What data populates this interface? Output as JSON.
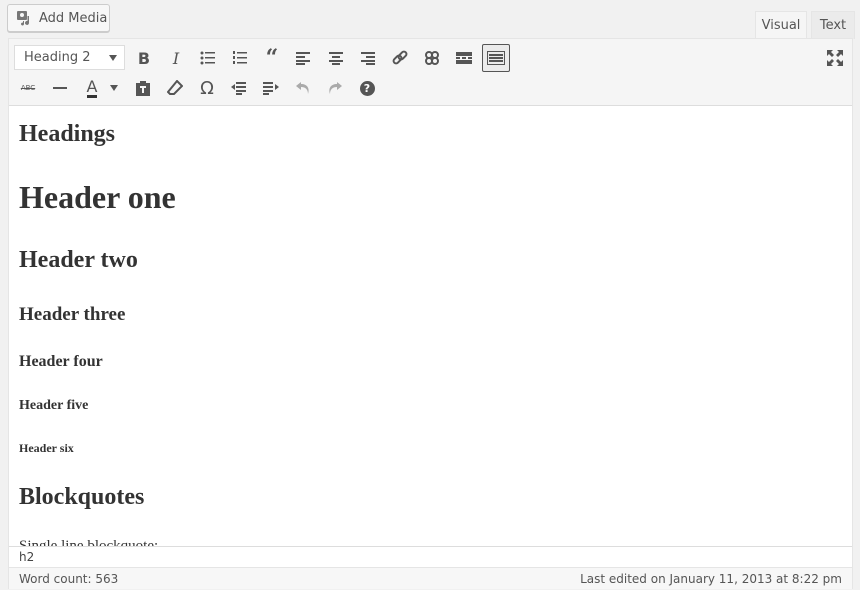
{
  "media": {
    "add_media_label": "Add Media"
  },
  "tabs": [
    {
      "label": "Visual",
      "active": true
    },
    {
      "label": "Text",
      "active": false
    }
  ],
  "toolbar": {
    "format_select": "Heading 2",
    "row1": [
      "bold-icon",
      "italic-icon",
      "bulleted-list-icon",
      "numbered-list-icon",
      "blockquote-icon",
      "align-left-icon",
      "align-center-icon",
      "align-right-icon",
      "link-icon",
      "unlink-icon",
      "read-more-icon",
      "toolbar-toggle-icon"
    ],
    "row2": [
      "strikethrough-icon",
      "horizontal-line-icon",
      "text-color-icon",
      "paste-as-text-icon",
      "clear-formatting-icon",
      "special-character-icon",
      "outdent-icon",
      "indent-icon",
      "undo-icon",
      "redo-icon",
      "help-icon"
    ],
    "fullscreen": "fullscreen-icon",
    "bold": "B",
    "italic": "I",
    "strike": "ABC",
    "text_color": "A",
    "omega": "Ω",
    "help": "?"
  },
  "content": {
    "headings": [
      {
        "level": "h2",
        "text": "Headings"
      },
      {
        "level": "h1",
        "text": "Header one"
      },
      {
        "level": "h2",
        "text": "Header two"
      },
      {
        "level": "h3",
        "text": "Header three"
      },
      {
        "level": "h4",
        "text": "Header four"
      },
      {
        "level": "h5",
        "text": "Header five"
      },
      {
        "level": "h6",
        "text": "Header six"
      },
      {
        "level": "h2",
        "text": "Blockquotes"
      }
    ],
    "partial_paragraph": "Single line blockquote:"
  },
  "path": "h2",
  "status": {
    "word_count": "Word count: 563",
    "last_edited": "Last edited on January 11, 2013 at 8:22 pm"
  }
}
